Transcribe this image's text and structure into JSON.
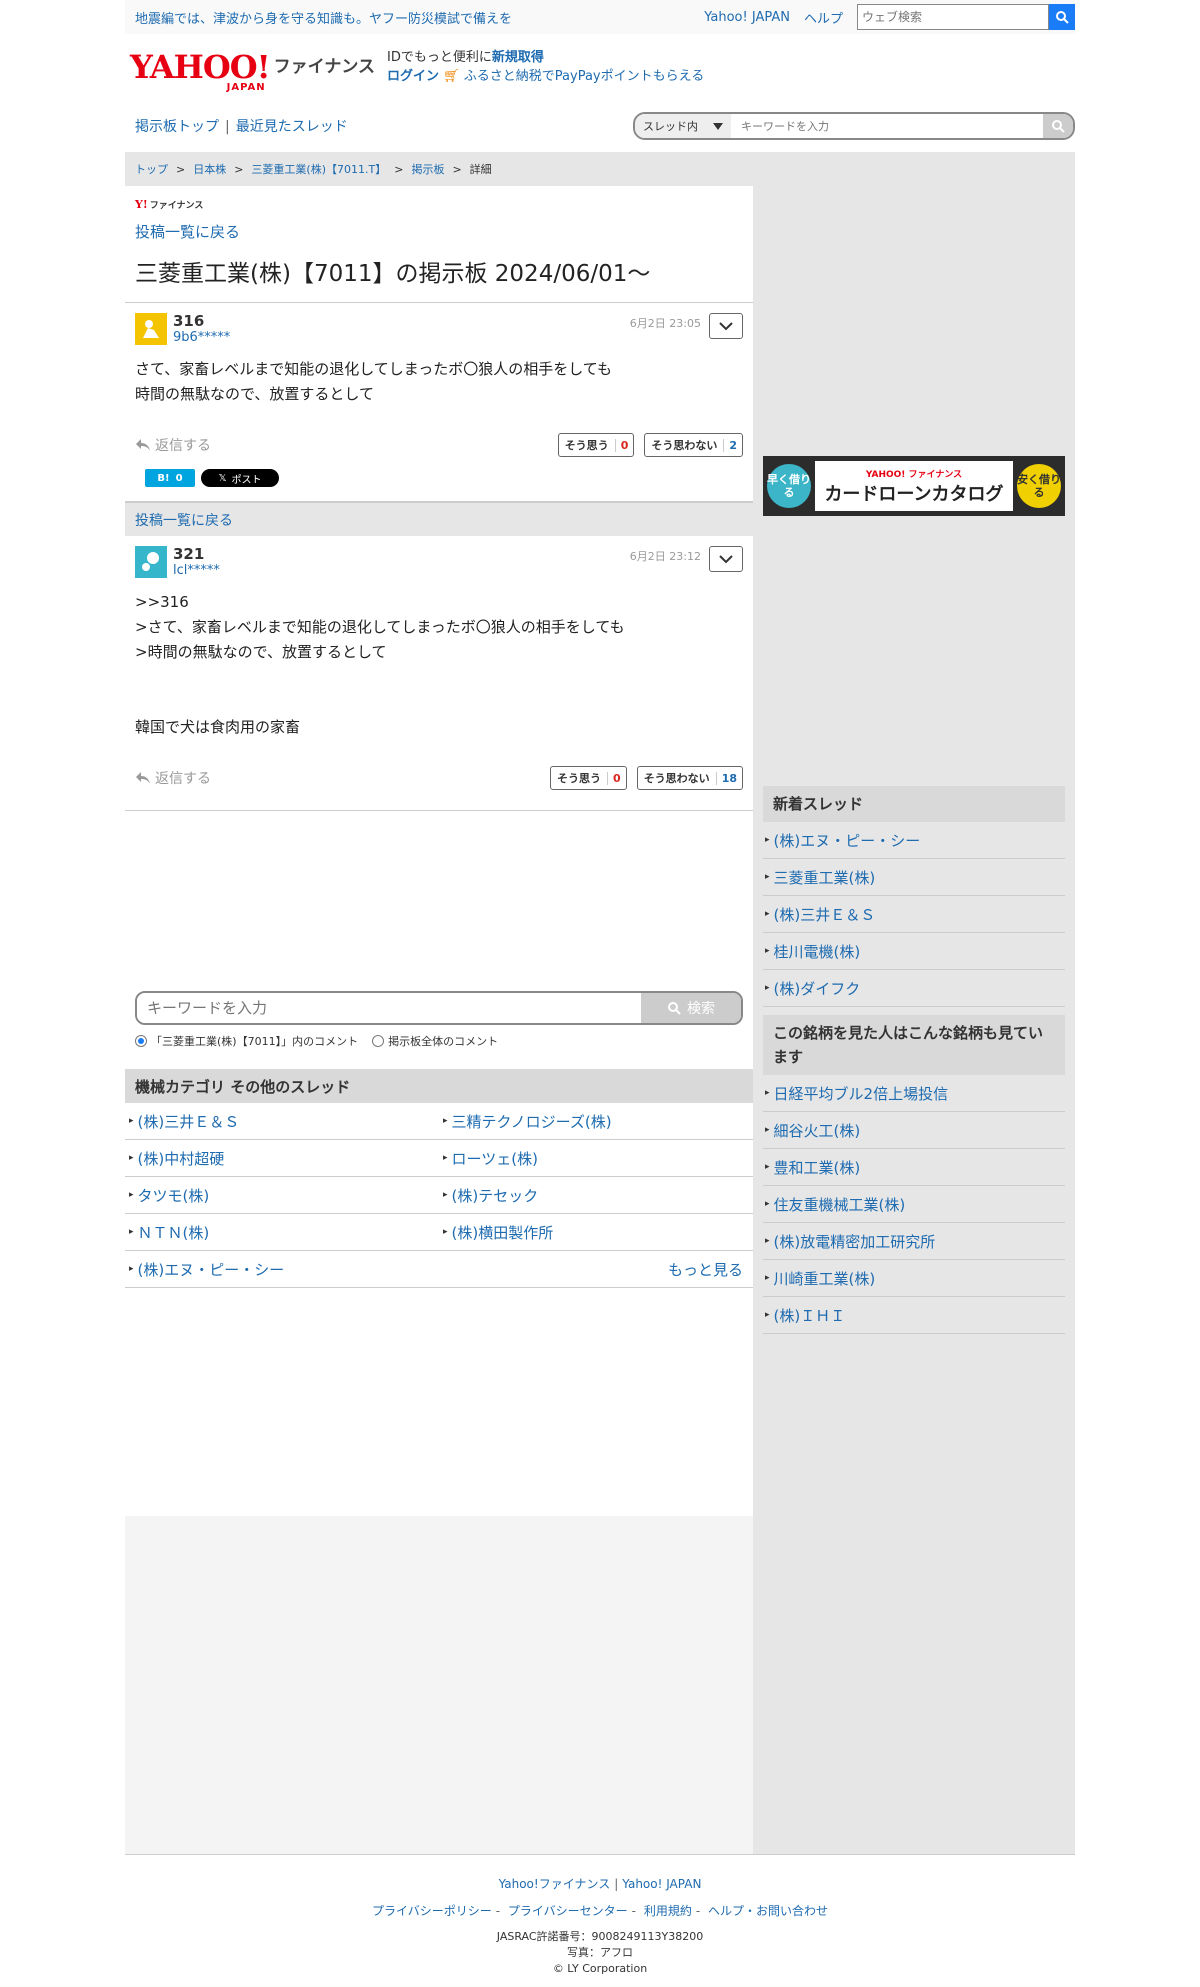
{
  "topbar": {
    "promo": "地震編では、津波から身を守る知識も。ヤフー防災模試で備えを",
    "yahoo_japan": "Yahoo! JAPAN",
    "help": "ヘルプ",
    "web_search_placeholder": "ウェブ検索"
  },
  "header": {
    "logo_text": "YAHOO!",
    "logo_japan": "JAPAN",
    "logo_finance": "ファイナンス",
    "id_prompt": "IDでもっと便利に",
    "signup": "新規取得",
    "login": "ログイン",
    "furusato": "ふるさと納税でPayPayポイントもらえる"
  },
  "boardnav": {
    "top": "掲示板トップ",
    "recent": "最近見たスレッド",
    "scope": "スレッド内",
    "placeholder": "キーワードを入力"
  },
  "breadcrumb": [
    "トップ",
    "日本株",
    "三菱重工業(株)【7011.T】",
    "掲示板",
    "詳細"
  ],
  "thread": {
    "mini_logo": "ファイナンス",
    "back": "投稿一覧に戻る",
    "title": "三菱重工業(株)【7011】の掲示板 2024/06/01〜"
  },
  "posts": [
    {
      "number": "316",
      "user": "9b6*****",
      "date": "6月2日 23:05",
      "body": "さて、家畜レベルまで知能の退化してしまったボ〇狼人の相手をしても\n時間の無駄なので、放置するとして",
      "reply": "返信する",
      "agree_label": "そう思う",
      "agree": "0",
      "disagree_label": "そう思わない",
      "disagree": "2"
    },
    {
      "number": "321",
      "user": "lcl*****",
      "date": "6月2日 23:12",
      "body": ">>316\n>さて、家畜レベルまで知能の退化してしまったボ〇狼人の相手をしても\n>時間の無駄なので、放置するとして\n\n\n韓国で犬は食肉用の家畜",
      "reply": "返信する",
      "agree_label": "そう思う",
      "agree": "0",
      "disagree_label": "そう思わない",
      "disagree": "18"
    }
  ],
  "share": {
    "hatena": "B!",
    "hatena_count": "0",
    "x": "ポスト"
  },
  "back_strip": "投稿一覧に戻る",
  "kw_search": {
    "placeholder": "キーワードを入力",
    "button": "検索",
    "radio1": "「三菱重工業(株)【7011】」内のコメント",
    "radio2": "掲示板全体のコメント"
  },
  "category": {
    "title": "機械カテゴリ  その他のスレッド",
    "items": [
      "(株)三井Ｅ＆Ｓ",
      "三精テクノロジーズ(株)",
      "(株)中村超硬",
      "ローツェ(株)",
      "タツモ(株)",
      "(株)テセック",
      "ＮＴＮ(株)",
      "(株)横田製作所",
      "(株)エヌ・ピー・シー"
    ],
    "more": "もっと見る"
  },
  "banner": {
    "left": "早く借りる",
    "brand": "YAHOO! ファイナンス",
    "main": "カードローンカタログ",
    "right": "安く借りる"
  },
  "sidebar": {
    "new_threads_title": "新着スレッド",
    "new_threads": [
      "(株)エヌ・ピー・シー",
      "三菱重工業(株)",
      "(株)三井Ｅ＆Ｓ",
      "桂川電機(株)",
      "(株)ダイフク"
    ],
    "related_title": "この銘柄を見た人はこんな銘柄も見ています",
    "related": [
      "日経平均ブル2倍上場投信",
      "細谷火工(株)",
      "豊和工業(株)",
      "住友重機械工業(株)",
      "(株)放電精密加工研究所",
      "川崎重工業(株)",
      "(株)ＩＨＩ"
    ]
  },
  "footer": {
    "links1": [
      "Yahoo!ファイナンス",
      "Yahoo! JAPAN"
    ],
    "links2": [
      "プライバシーポリシー",
      "プライバシーセンター",
      "利用規約",
      "ヘルプ・お問い合わせ"
    ],
    "jasrac": "JASRAC許諾番号：9008249113Y38200",
    "photo": "写真：アフロ",
    "copyright": "© LY Corporation"
  },
  "colors": {
    "link": "#1e6bb0",
    "accent_red": "#d9261c",
    "search_blue": "#1b7cf7"
  }
}
